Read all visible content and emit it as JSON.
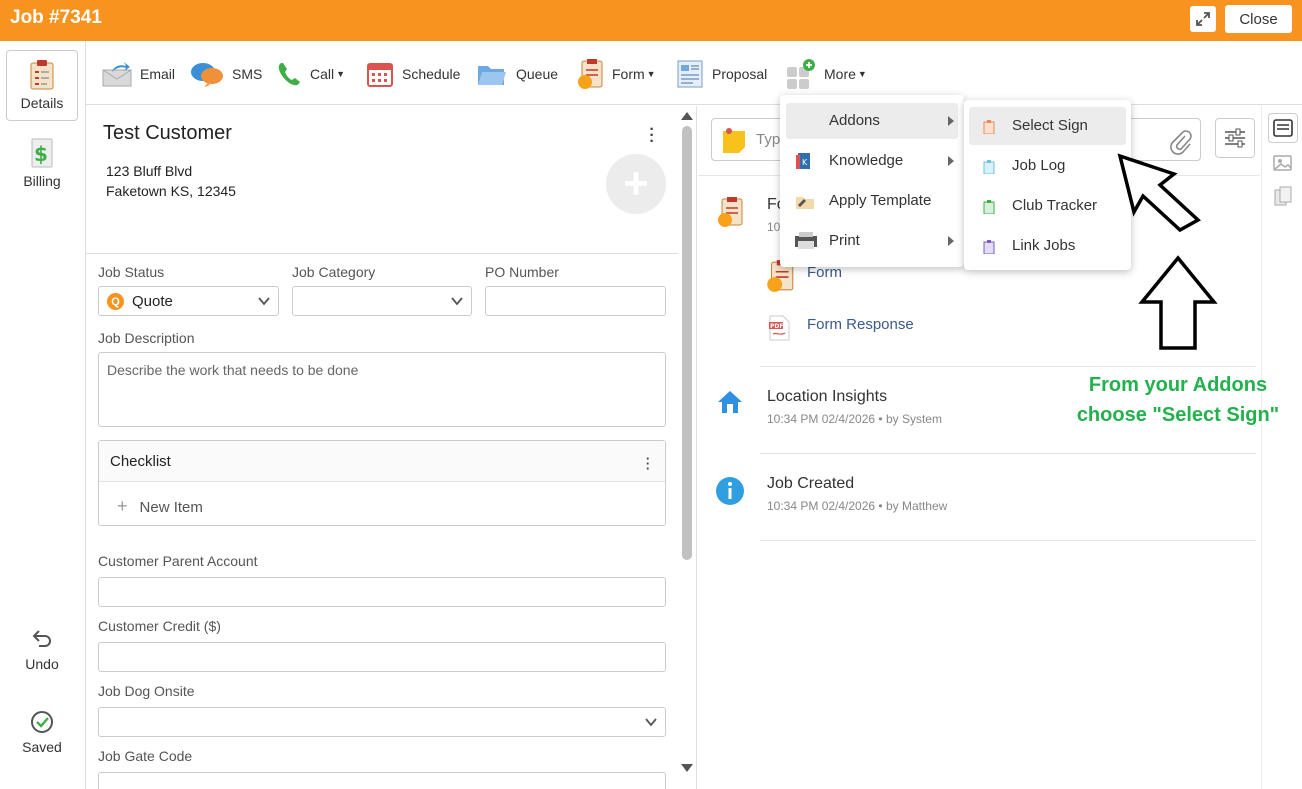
{
  "window": {
    "title": "Job #7341",
    "close_label": "Close"
  },
  "leftnav": {
    "details_label": "Details",
    "billing_label": "Billing",
    "undo_label": "Undo",
    "saved_label": "Saved"
  },
  "toolbar": {
    "email": "Email",
    "sms": "SMS",
    "call": "Call",
    "schedule": "Schedule",
    "queue": "Queue",
    "form": "Form",
    "proposal": "Proposal",
    "more": "More"
  },
  "customer": {
    "name": "Test Customer",
    "address_line1": "123 Bluff Blvd",
    "address_line2": "Faketown KS, 12345"
  },
  "form": {
    "job_status_label": "Job Status",
    "job_status_value": "Quote",
    "job_status_badge": "Q",
    "job_category_label": "Job Category",
    "job_category_value": "",
    "po_number_label": "PO Number",
    "po_number_value": "",
    "job_description_label": "Job Description",
    "job_description_placeholder": "Describe the work that needs to be done",
    "checklist_title": "Checklist",
    "checklist_new_item": "New Item",
    "customer_parent_account_label": "Customer Parent Account",
    "customer_credit_label": "Customer Credit ($)",
    "job_dog_onsite_label": "Job Dog Onsite",
    "job_gate_code_label": "Job Gate Code"
  },
  "notes": {
    "placeholder": "Typ"
  },
  "timeline": [
    {
      "title": "Fo",
      "meta": "10",
      "links": [
        "Form",
        "Form Response"
      ]
    },
    {
      "title": "Location Insights",
      "meta": "10:34 PM 02/4/2026 •  by System"
    },
    {
      "title": "Job Created",
      "meta": "10:34 PM 02/4/2026 •  by Matthew"
    }
  ],
  "more_menu": {
    "items": [
      "Addons",
      "Knowledge",
      "Apply Template",
      "Print"
    ]
  },
  "addons_menu": {
    "items": [
      "Select Sign",
      "Job Log",
      "Club Tracker",
      "Link Jobs"
    ]
  },
  "annotation": {
    "line1": "From your Addons",
    "line2": "choose \"Select Sign\""
  },
  "colors": {
    "accent": "#f7931e",
    "annotation_green": "#22b14c",
    "link_blue": "#3a5a8c"
  }
}
